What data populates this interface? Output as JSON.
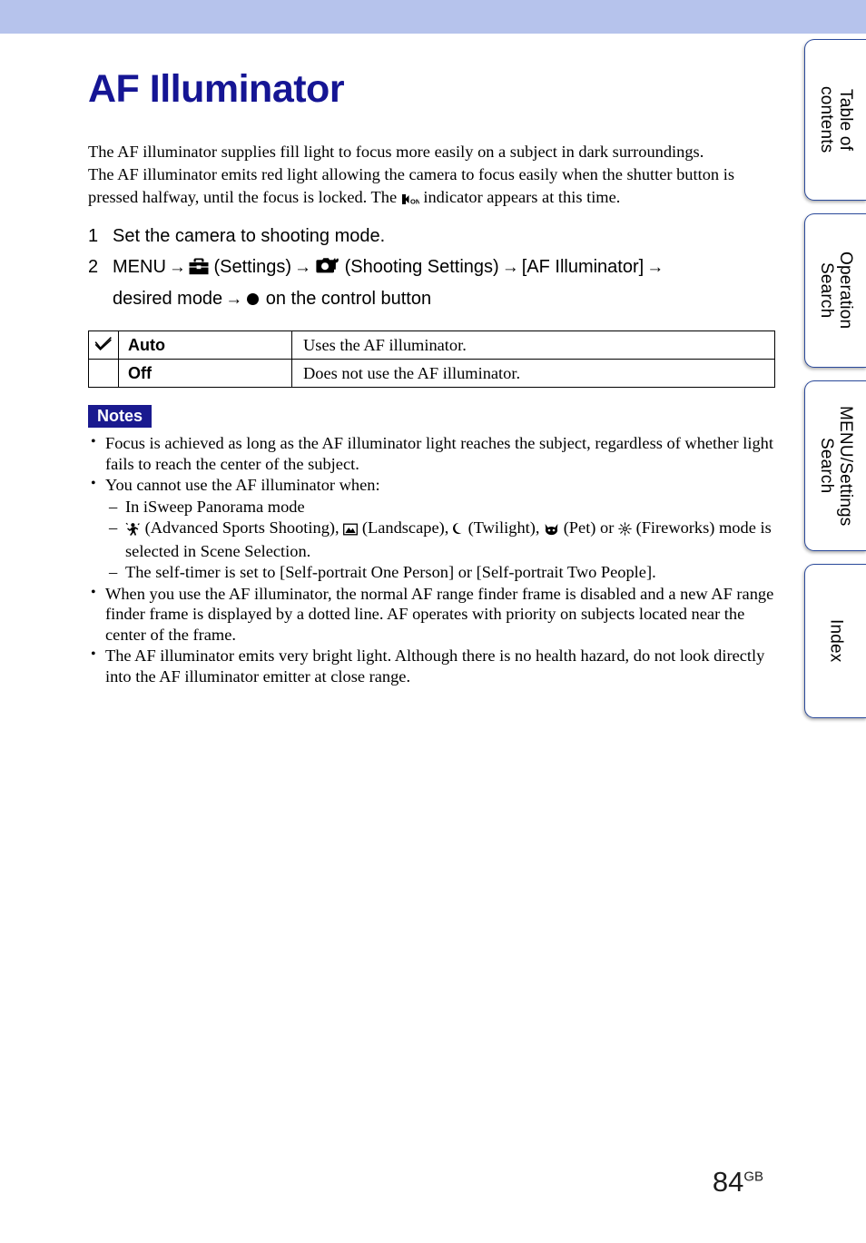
{
  "header": {
    "band_color": "#b6c3ec"
  },
  "page": {
    "title": "AF Illuminator",
    "title_color": "#151594",
    "number": "84",
    "number_suffix": "GB"
  },
  "intro": {
    "line1": "The AF illuminator supplies fill light to focus more easily on a subject in dark surroundings.",
    "line2": "The AF illuminator emits red light allowing the camera to focus easily when the shutter button is",
    "line3_before": "pressed halfway, until the focus is locked. The ",
    "indicator_icon": "af-illuminator-on-icon",
    "line3_after": " indicator appears at this time."
  },
  "steps": [
    {
      "number": "1",
      "text": "Set the camera to shooting mode."
    },
    {
      "number": "2",
      "menu_label": "MENU",
      "arrow": "→",
      "settings_icon": "toolbox-settings-icon",
      "settings_label": "(Settings)",
      "shooting_icon": "camera-wrench-icon",
      "shooting_label": "(Shooting Settings)",
      "bracket_label": "[AF Illuminator]",
      "desired_mode": "desired mode",
      "control_button_label": "on the control button"
    }
  ],
  "option_table": {
    "rows": [
      {
        "selected": true,
        "check_icon": "checkmark-icon",
        "label": "Auto",
        "description": "Uses the AF illuminator."
      },
      {
        "selected": false,
        "check_icon": "",
        "label": "Off",
        "description": "Does not use the AF illuminator."
      }
    ]
  },
  "notes": {
    "badge": "Notes",
    "badge_bg": "#1a1a8f",
    "badge_color": "#ffffff",
    "items": [
      {
        "text": "Focus is achieved as long as the AF illuminator light reaches the subject, regardless of whether light fails to reach the center of the subject."
      },
      {
        "text": "You cannot use the AF illuminator when:",
        "sub": [
          {
            "text": "In iSweep Panorama mode"
          },
          {
            "scene_prefix": "",
            "icons": [
              {
                "name": "advanced-sports-shooting-icon",
                "label": "(Advanced Sports Shooting),"
              },
              {
                "name": "landscape-icon",
                "label": "(Landscape),"
              },
              {
                "name": "twilight-icon",
                "label": "(Twilight),"
              },
              {
                "name": "pet-icon",
                "label": "(Pet) or"
              },
              {
                "name": "fireworks-icon",
                "label": "(Fireworks) mode is"
              }
            ],
            "tail": "selected in Scene Selection."
          },
          {
            "text": "The self-timer is set to [Self-portrait One Person] or [Self-portrait Two People]."
          }
        ]
      },
      {
        "text": "When you use the AF illuminator, the normal AF range finder frame is disabled and a new AF range finder frame is displayed by a dotted line. AF operates with priority on subjects located near the center of the frame."
      },
      {
        "text": "The AF illuminator emits very bright light. Although there is no health hazard, do not look directly into the AF illuminator emitter at close range."
      }
    ]
  },
  "side_tabs": [
    {
      "id": "toc",
      "label": "Table of\ncontents"
    },
    {
      "id": "op",
      "label": "Operation\nSearch"
    },
    {
      "id": "menu",
      "label": "MENU/Settings\nSearch"
    },
    {
      "id": "index",
      "label": "Index"
    }
  ]
}
